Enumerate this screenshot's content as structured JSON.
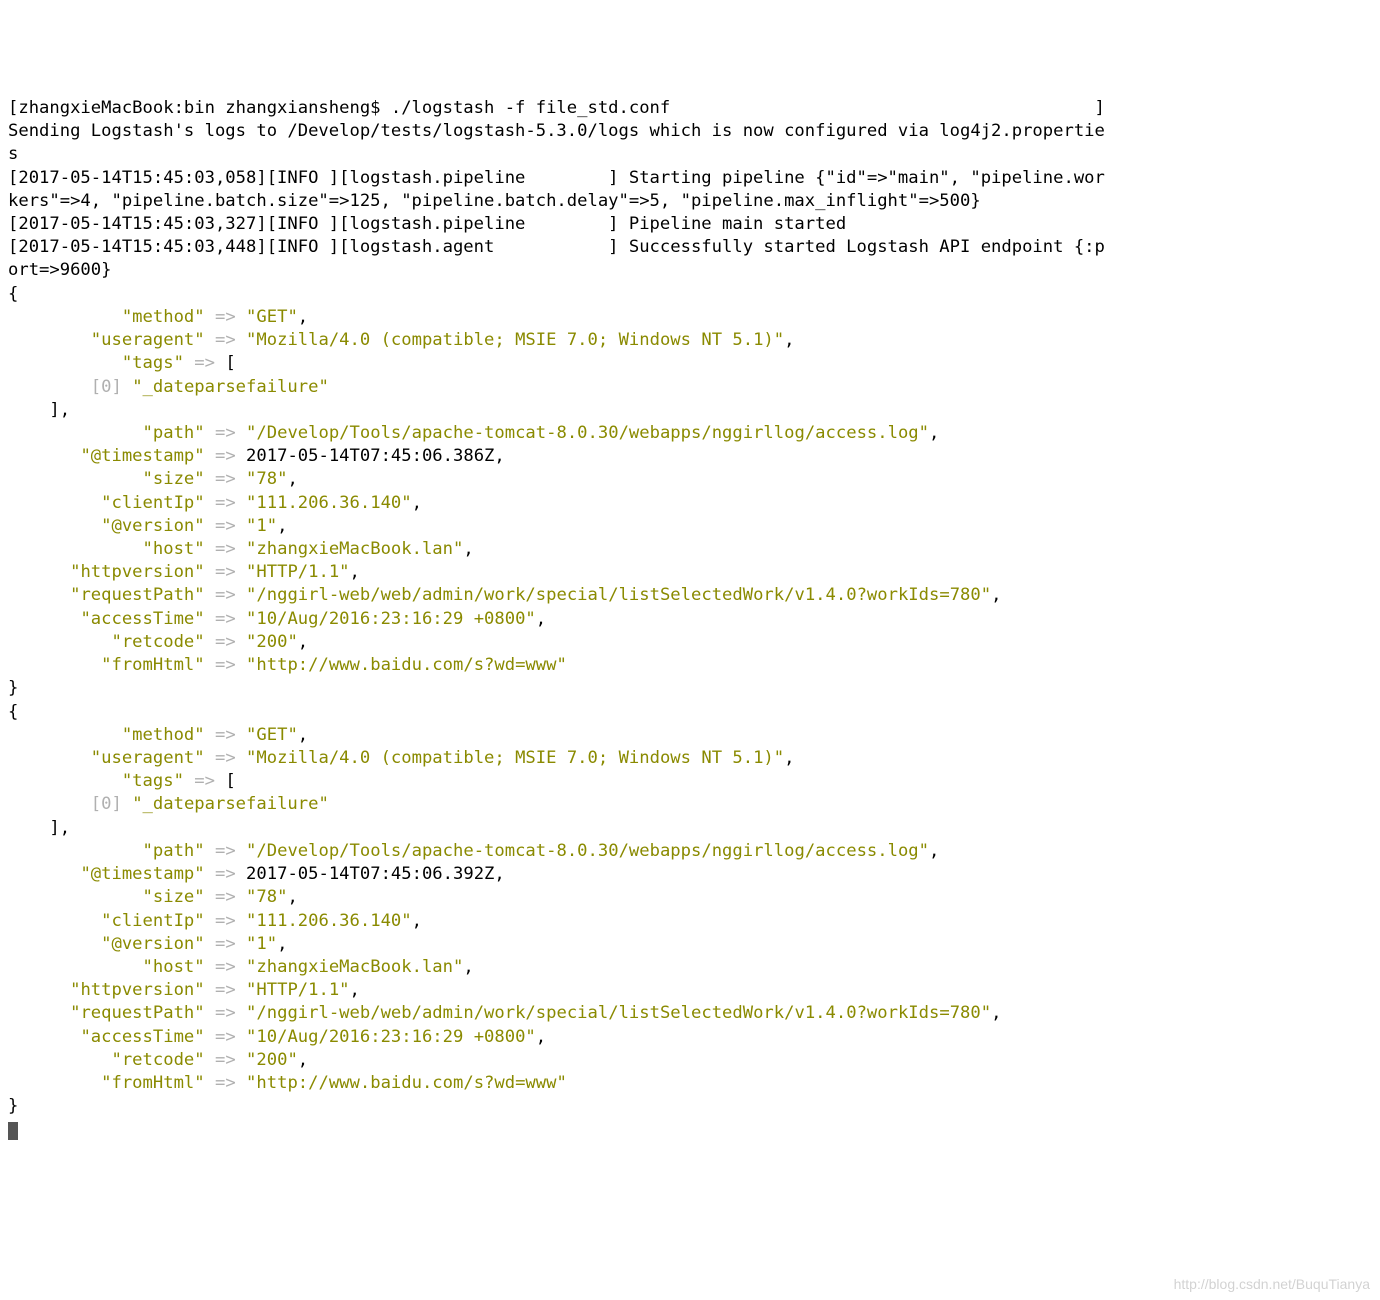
{
  "prompt": "[zhangxieMacBook:bin zhangxiansheng$ ./logstash -f file_std.conf",
  "startup": [
    "Sending Logstash's logs to /Develop/tests/logstash-5.3.0/logs which is now configured via log4j2.properties",
    "[2017-05-14T15:45:03,058][INFO ][logstash.pipeline        ] Starting pipeline {\"id\"=>\"main\", \"pipeline.workers\"=>4, \"pipeline.batch.size\"=>125, \"pipeline.batch.delay\"=>5, \"pipeline.max_inflight\"=>500}",
    "[2017-05-14T15:45:03,327][INFO ][logstash.pipeline        ] Pipeline main started",
    "[2017-05-14T15:45:03,448][INFO ][logstash.agent           ] Successfully started Logstash API endpoint {:port=>9600}"
  ],
  "events": [
    {
      "method": "\"GET\"",
      "useragent": "\"Mozilla/4.0 (compatible; MSIE 7.0; Windows NT 5.1)\"",
      "tags": [
        "\"_dateparsefailure\""
      ],
      "path": "\"/Develop/Tools/apache-tomcat-8.0.30/webapps/nggirllog/access.log\"",
      "@timestamp": "2017-05-14T07:45:06.386Z",
      "size": "\"78\"",
      "clientIp": "\"111.206.36.140\"",
      "@version": "\"1\"",
      "host": "\"zhangxieMacBook.lan\"",
      "httpversion": "\"HTTP/1.1\"",
      "requestPath": "\"/nggirl-web/web/admin/work/special/listSelectedWork/v1.4.0?workIds=780\"",
      "accessTime": "\"10/Aug/2016:23:16:29 +0800\"",
      "retcode": "\"200\"",
      "fromHtml": "\"http://www.baidu.com/s?wd=www\""
    },
    {
      "method": "\"GET\"",
      "useragent": "\"Mozilla/4.0 (compatible; MSIE 7.0; Windows NT 5.1)\"",
      "tags": [
        "\"_dateparsefailure\""
      ],
      "path": "\"/Develop/Tools/apache-tomcat-8.0.30/webapps/nggirllog/access.log\"",
      "@timestamp": "2017-05-14T07:45:06.392Z",
      "size": "\"78\"",
      "clientIp": "\"111.206.36.140\"",
      "@version": "\"1\"",
      "host": "\"zhangxieMacBook.lan\"",
      "httpversion": "\"HTTP/1.1\"",
      "requestPath": "\"/nggirl-web/web/admin/work/special/listSelectedWork/v1.4.0?workIds=780\"",
      "accessTime": "\"10/Aug/2016:23:16:29 +0800\"",
      "retcode": "\"200\"",
      "fromHtml": "\"http://www.baidu.com/s?wd=www\""
    }
  ],
  "watermark": "http://blog.csdn.net/BuquTianya"
}
